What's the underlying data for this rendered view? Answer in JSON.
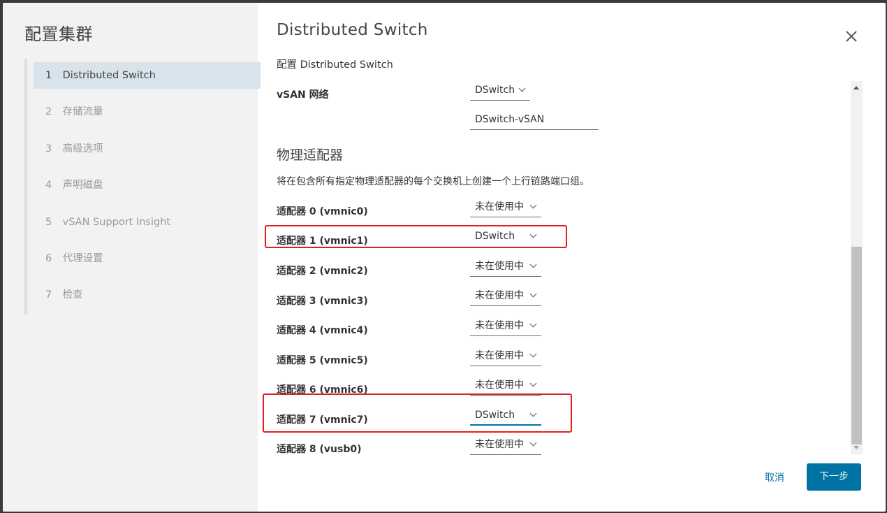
{
  "wizard": {
    "title": "配置集群",
    "steps": [
      {
        "num": "1",
        "label": "Distributed Switch"
      },
      {
        "num": "2",
        "label": "存储流量"
      },
      {
        "num": "3",
        "label": "高级选项"
      },
      {
        "num": "4",
        "label": "声明磁盘"
      },
      {
        "num": "5",
        "label": "vSAN Support Insight"
      },
      {
        "num": "6",
        "label": "代理设置"
      },
      {
        "num": "7",
        "label": "检查"
      }
    ],
    "active_step": 1
  },
  "page": {
    "title": "Distributed Switch",
    "subtitle": "配置 Distributed Switch",
    "vsan_network_label": "vSAN 网络",
    "vsan_network_switch": "DSwitch",
    "vsan_portgroup": "DSwitch-vSAN",
    "section_title": "物理适配器",
    "description": "将在包含所有指定物理适配器的每个交换机上创建一个上行链路端口组。"
  },
  "adapters": [
    {
      "label": "适配器 0 (vmnic0)",
      "value": "未在使用中"
    },
    {
      "label": "适配器 1 (vmnic1)",
      "value": "DSwitch"
    },
    {
      "label": "适配器 2 (vmnic2)",
      "value": "未在使用中"
    },
    {
      "label": "适配器 3 (vmnic3)",
      "value": "未在使用中"
    },
    {
      "label": "适配器 4 (vmnic4)",
      "value": "未在使用中"
    },
    {
      "label": "适配器 5 (vmnic5)",
      "value": "未在使用中"
    },
    {
      "label": "适配器 6 (vmnic6)",
      "value": "未在使用中"
    },
    {
      "label": "适配器 7 (vmnic7)",
      "value": "DSwitch"
    },
    {
      "label": "适配器 8 (vusb0)",
      "value": "未在使用中"
    }
  ],
  "footer": {
    "cancel_label": "取消",
    "next_label": "下一步"
  },
  "colors": {
    "accent": "#0072a3",
    "highlight": "#e02020",
    "sidebar_bg": "#f2f2f2",
    "active_step_bg": "#d8e3eb"
  }
}
